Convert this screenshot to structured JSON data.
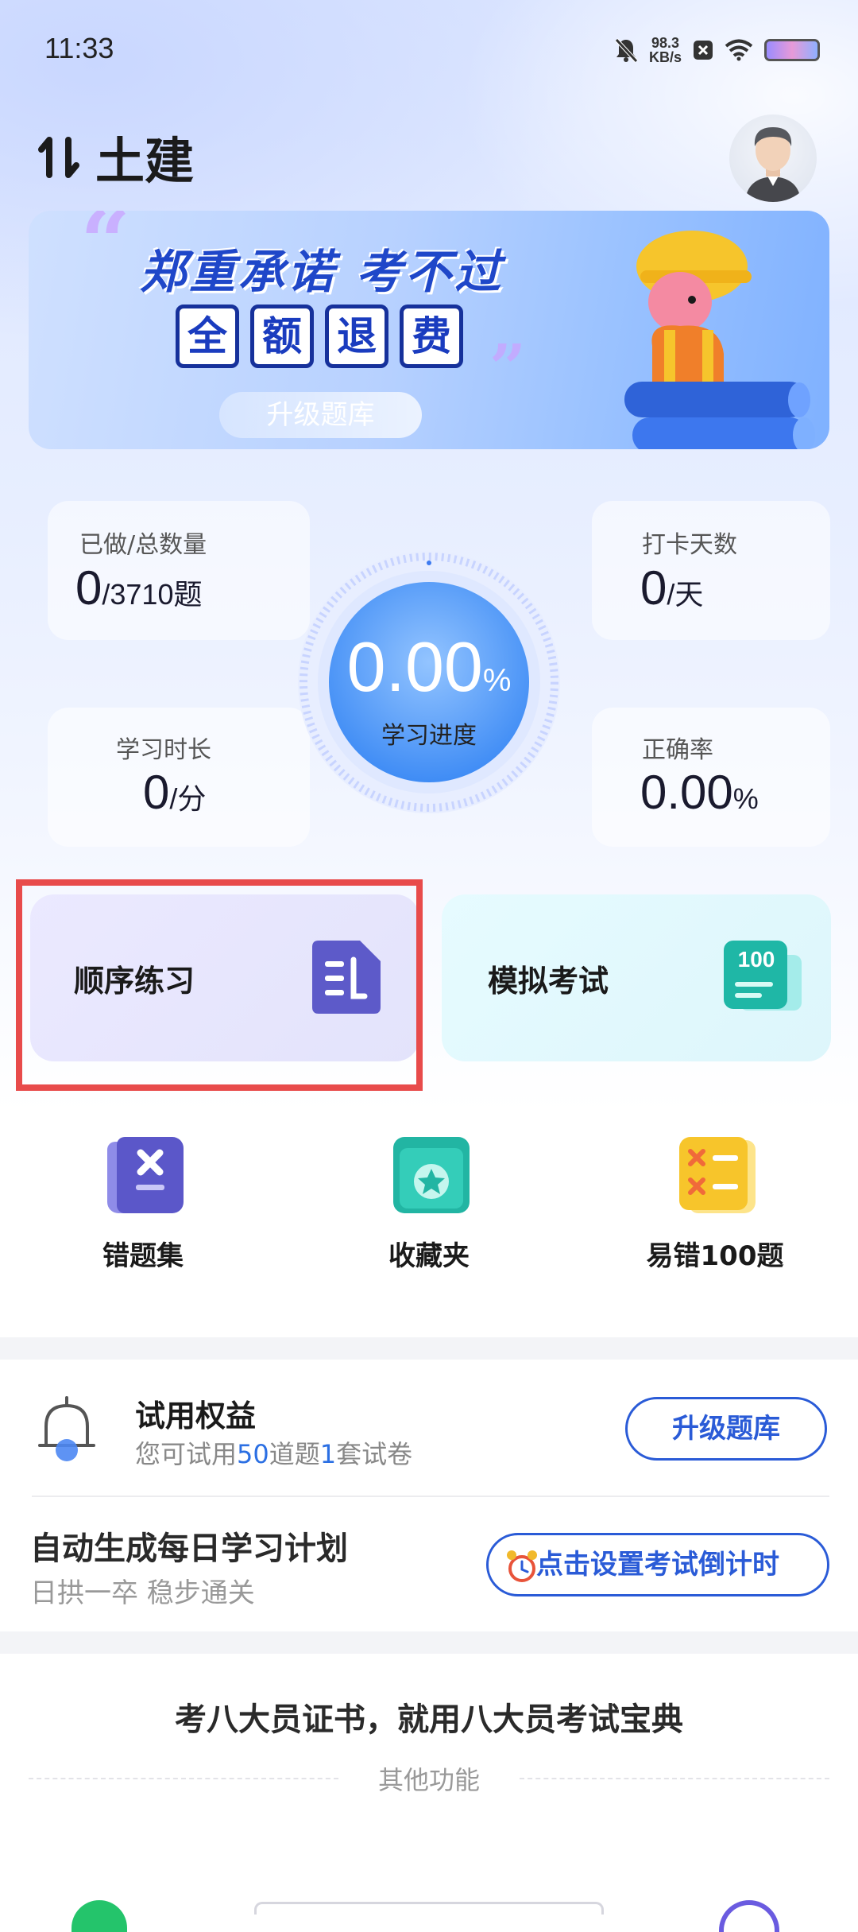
{
  "status_bar": {
    "time": "11:33",
    "net_speed": "98.3",
    "net_unit": "KB/s"
  },
  "header": {
    "city": "土建"
  },
  "banner": {
    "title": "郑重承诺 考不过",
    "chars": [
      "全",
      "额",
      "退",
      "费"
    ],
    "upgrade_label": "升级题库"
  },
  "stats": {
    "done_label": "已做/总数量",
    "done_value": "0",
    "done_unit": "/3710题",
    "checkin_label": "打卡天数",
    "checkin_value": "0",
    "checkin_unit": "/天",
    "time_label": "学习时长",
    "time_value": "0",
    "time_unit": "/分",
    "accuracy_label": "正确率",
    "accuracy_value": "0.00",
    "accuracy_unit": "%",
    "progress_value": "0.00",
    "progress_unit": "%",
    "progress_label": "学习进度",
    "progress_fraction": 0.0
  },
  "practice": {
    "sequential_label": "顺序练习",
    "mock_label": "模拟考试",
    "mock_icon_text": "100"
  },
  "quick_links": [
    {
      "label": "错题集",
      "icon": "wrong-book-icon"
    },
    {
      "label": "收藏夹",
      "icon": "favorites-icon"
    },
    {
      "label": "易错100题",
      "icon": "error-prone-icon"
    }
  ],
  "trial": {
    "title": "试用权益",
    "sub_prefix": "您可试用",
    "questions_count": "50",
    "sub_mid": "道题",
    "papers_count": "1",
    "sub_suffix": "套试卷",
    "upgrade_button": "升级题库"
  },
  "plan": {
    "title": "自动生成每日学习计划",
    "subtitle": "日拱一卒 稳步通关",
    "countdown_button": "点击设置考试倒计时"
  },
  "footer": {
    "slogan": "考八大员证书，就用八大员考试宝典",
    "other_functions": "其他功能"
  },
  "colors": {
    "accent": "#2a5bd7",
    "highlight_border": "#e84b4b",
    "count_blue": "#2b6fe3"
  }
}
